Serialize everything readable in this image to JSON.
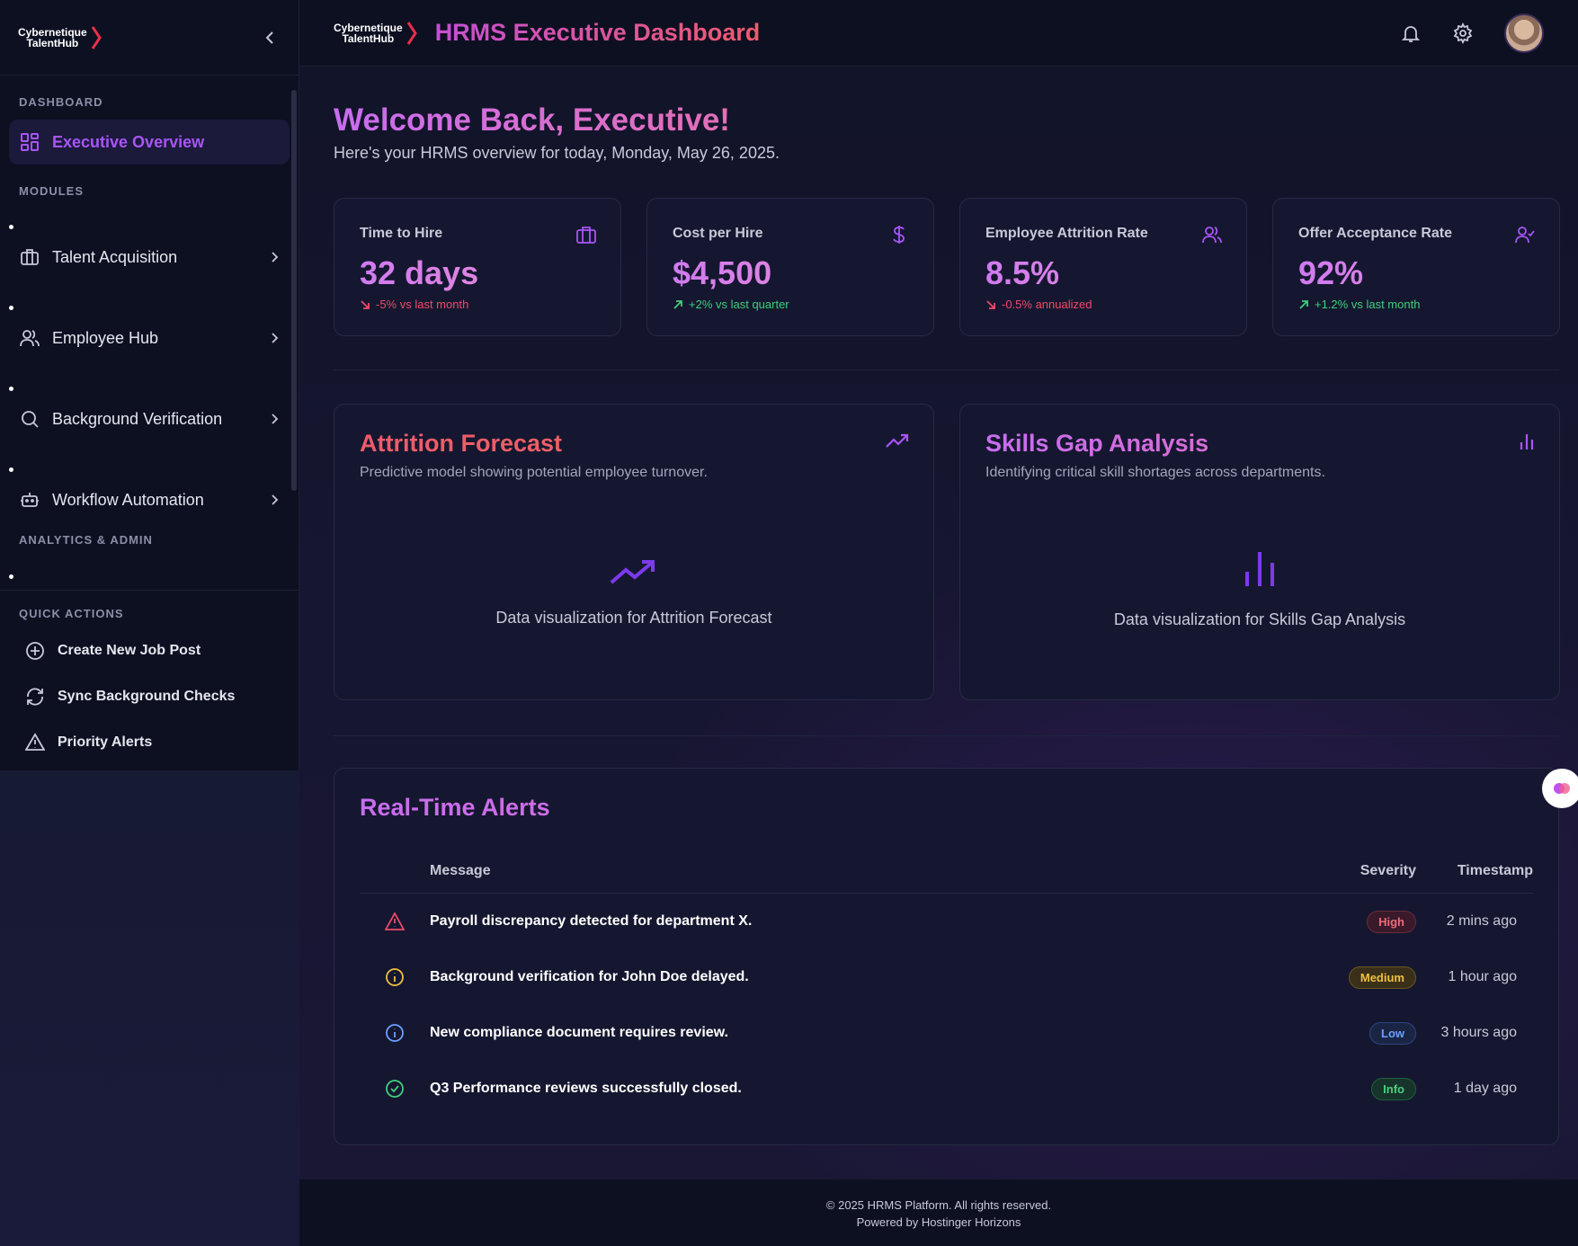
{
  "brand": {
    "line1": "Cybernetique",
    "line2": "TalentHub"
  },
  "header": {
    "title": "HRMS Executive Dashboard"
  },
  "sidebar": {
    "section_dashboard": "DASHBOARD",
    "active_item": "Executive Overview",
    "section_modules": "MODULES",
    "modules": [
      {
        "label": "Talent Acquisition",
        "icon": "briefcase-icon"
      },
      {
        "label": "Employee Hub",
        "icon": "users-icon"
      },
      {
        "label": "Background Verification",
        "icon": "search-icon"
      },
      {
        "label": "Workflow Automation",
        "icon": "bot-icon"
      }
    ],
    "section_analytics": "ANALYTICS & ADMIN",
    "section_quick": "QUICK ACTIONS",
    "quick_actions": [
      {
        "label": "Create New Job Post",
        "icon": "plus-circle-icon"
      },
      {
        "label": "Sync Background Checks",
        "icon": "refresh-icon"
      },
      {
        "label": "Priority Alerts",
        "icon": "warning-icon"
      }
    ]
  },
  "welcome": {
    "title": "Welcome Back, Executive!",
    "subtitle": "Here's your HRMS overview for today, Monday, May 26, 2025."
  },
  "kpis": [
    {
      "title": "Time to Hire",
      "value": "32 days",
      "delta": "-5% vs last month",
      "trend": "down"
    },
    {
      "title": "Cost per Hire",
      "value": "$4,500",
      "delta": "+2% vs last quarter",
      "trend": "up"
    },
    {
      "title": "Employee Attrition Rate",
      "value": "8.5%",
      "delta": "-0.5% annualized",
      "trend": "down"
    },
    {
      "title": "Offer Acceptance Rate",
      "value": "92%",
      "delta": "+1.2% vs last month",
      "trend": "up"
    }
  ],
  "charts": [
    {
      "title": "Attrition Forecast",
      "subtitle": "Predictive model showing potential employee turnover.",
      "placeholder": "Data visualization for Attrition Forecast"
    },
    {
      "title": "Skills Gap Analysis",
      "subtitle": "Identifying critical skill shortages across departments.",
      "placeholder": "Data visualization for Skills Gap Analysis"
    }
  ],
  "alerts": {
    "title": "Real-Time Alerts",
    "columns": {
      "message": "Message",
      "severity": "Severity",
      "timestamp": "Timestamp"
    },
    "rows": [
      {
        "message": "Payroll discrepancy detected for department X.",
        "severity": "High",
        "time": "2 mins ago",
        "icon": "warning-icon"
      },
      {
        "message": "Background verification for John Doe delayed.",
        "severity": "Medium",
        "time": "1 hour ago",
        "icon": "info-icon"
      },
      {
        "message": "New compliance document requires review.",
        "severity": "Low",
        "time": "3 hours ago",
        "icon": "info-icon"
      },
      {
        "message": "Q3 Performance reviews successfully closed.",
        "severity": "Info",
        "time": "1 day ago",
        "icon": "check-circle-icon"
      }
    ]
  },
  "footer": {
    "copyright": "© 2025 HRMS Platform. All rights reserved.",
    "powered": "Powered by Hostinger Horizons"
  },
  "colors": {
    "accent": "#a855f7",
    "negative": "#f04a6a",
    "positive": "#3fd07a"
  }
}
